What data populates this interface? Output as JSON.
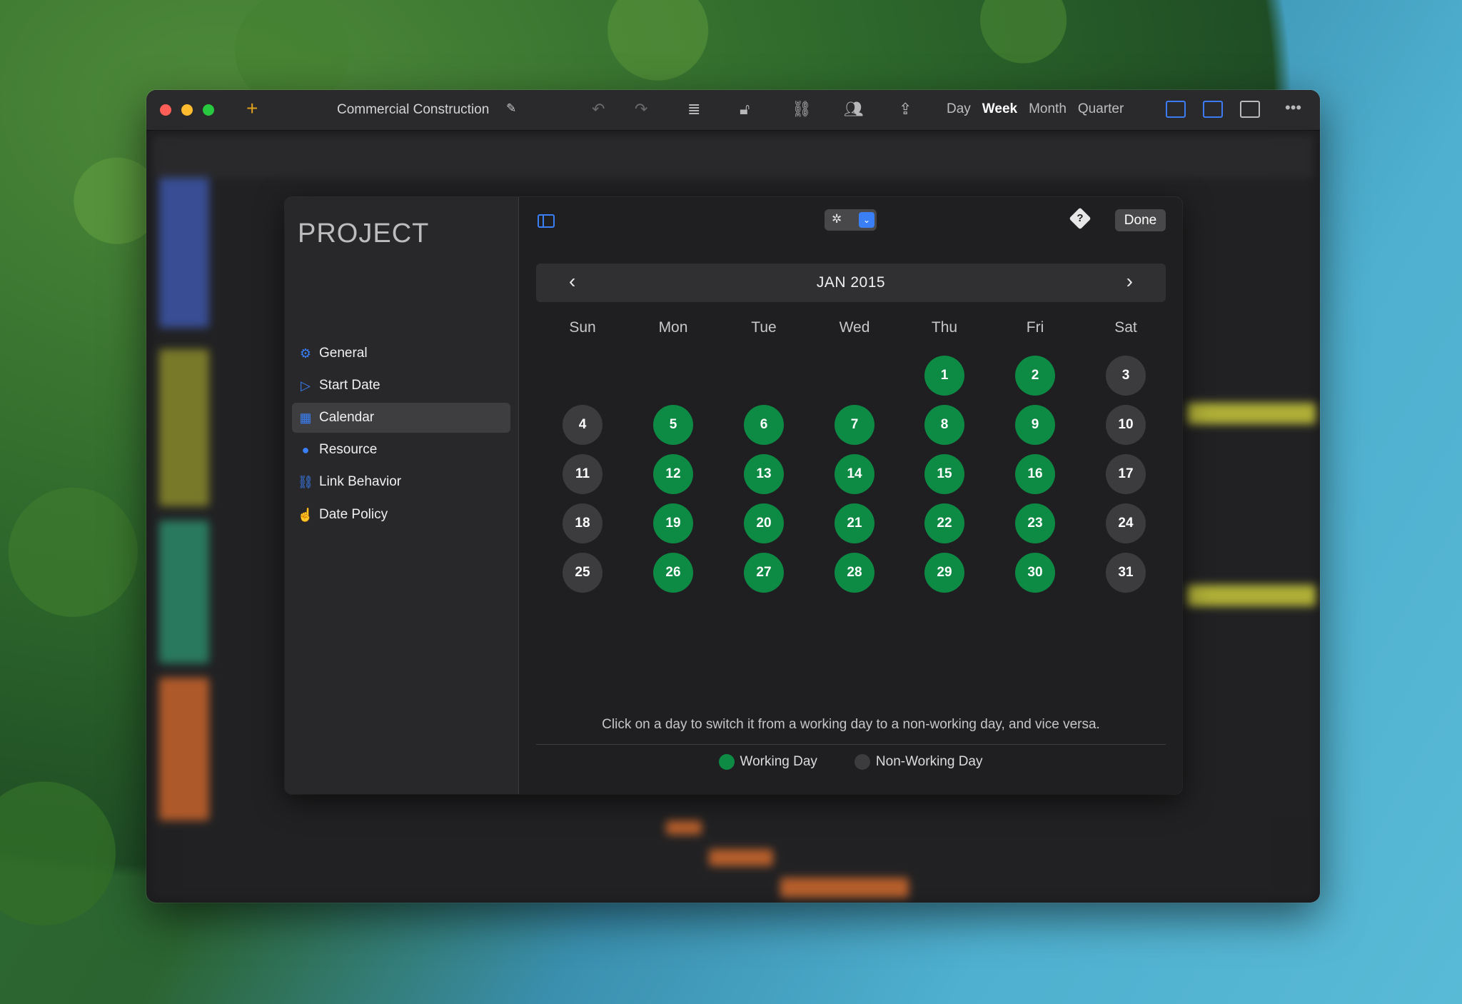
{
  "window": {
    "title": "Commercial Construction",
    "views": [
      "Day",
      "Week",
      "Month",
      "Quarter"
    ],
    "active_view": "Week"
  },
  "sidebar": {
    "title": "PROJECT",
    "items": [
      {
        "label": "General",
        "icon": "gears-icon"
      },
      {
        "label": "Start Date",
        "icon": "start-arrow-icon"
      },
      {
        "label": "Calendar",
        "icon": "calendar-icon",
        "selected": true
      },
      {
        "label": "Resource",
        "icon": "person-icon"
      },
      {
        "label": "Link Behavior",
        "icon": "link-icon"
      },
      {
        "label": "Date Policy",
        "icon": "hand-pointer-icon"
      }
    ]
  },
  "header": {
    "done_label": "Done",
    "help_label": "?"
  },
  "calendar": {
    "month_label": "JAN 2015",
    "weekdays": [
      "Sun",
      "Mon",
      "Tue",
      "Wed",
      "Thu",
      "Fri",
      "Sat"
    ],
    "first_weekday_index": 4,
    "days": [
      {
        "d": "1",
        "w": true
      },
      {
        "d": "2",
        "w": true
      },
      {
        "d": "3",
        "w": false
      },
      {
        "d": "4",
        "w": false
      },
      {
        "d": "5",
        "w": true
      },
      {
        "d": "6",
        "w": true
      },
      {
        "d": "7",
        "w": true
      },
      {
        "d": "8",
        "w": true
      },
      {
        "d": "9",
        "w": true
      },
      {
        "d": "10",
        "w": false
      },
      {
        "d": "11",
        "w": false
      },
      {
        "d": "12",
        "w": true
      },
      {
        "d": "13",
        "w": true
      },
      {
        "d": "14",
        "w": true
      },
      {
        "d": "15",
        "w": true
      },
      {
        "d": "16",
        "w": true
      },
      {
        "d": "17",
        "w": false
      },
      {
        "d": "18",
        "w": false
      },
      {
        "d": "19",
        "w": true
      },
      {
        "d": "20",
        "w": true
      },
      {
        "d": "21",
        "w": true
      },
      {
        "d": "22",
        "w": true
      },
      {
        "d": "23",
        "w": true
      },
      {
        "d": "24",
        "w": false
      },
      {
        "d": "25",
        "w": false
      },
      {
        "d": "26",
        "w": true
      },
      {
        "d": "27",
        "w": true
      },
      {
        "d": "28",
        "w": true
      },
      {
        "d": "29",
        "w": true
      },
      {
        "d": "30",
        "w": true
      },
      {
        "d": "31",
        "w": false
      }
    ],
    "hint": "Click on a day to switch it from a working day to a non-working day, and vice versa.",
    "legend": [
      {
        "label": "Working Day",
        "color": "#0d8a44"
      },
      {
        "label": "Non-Working Day",
        "color": "#3c3c3f"
      }
    ]
  },
  "colors": {
    "accent": "#3a7ff6",
    "working": "#0d8a44",
    "non_working": "#3c3c3f"
  }
}
